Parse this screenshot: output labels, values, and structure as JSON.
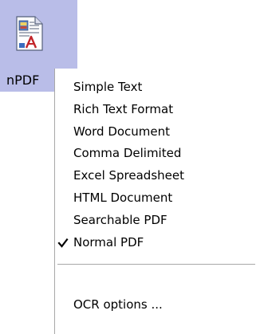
{
  "app_icon": {
    "icon": "document-icon",
    "label": "nPDF"
  },
  "menu": {
    "items": [
      {
        "label": "Simple Text",
        "checked": false
      },
      {
        "label": "Rich Text Format",
        "checked": false
      },
      {
        "label": "Word Document",
        "checked": false
      },
      {
        "label": "Comma Delimited",
        "checked": false
      },
      {
        "label": "Excel Spreadsheet",
        "checked": false
      },
      {
        "label": "HTML Document",
        "checked": false
      },
      {
        "label": "Searchable PDF",
        "checked": false
      },
      {
        "label": "Normal PDF",
        "checked": true
      }
    ],
    "options_label": "OCR options ..."
  },
  "colors": {
    "selection": "#b9bde8",
    "separator": "#a8a8a8"
  }
}
